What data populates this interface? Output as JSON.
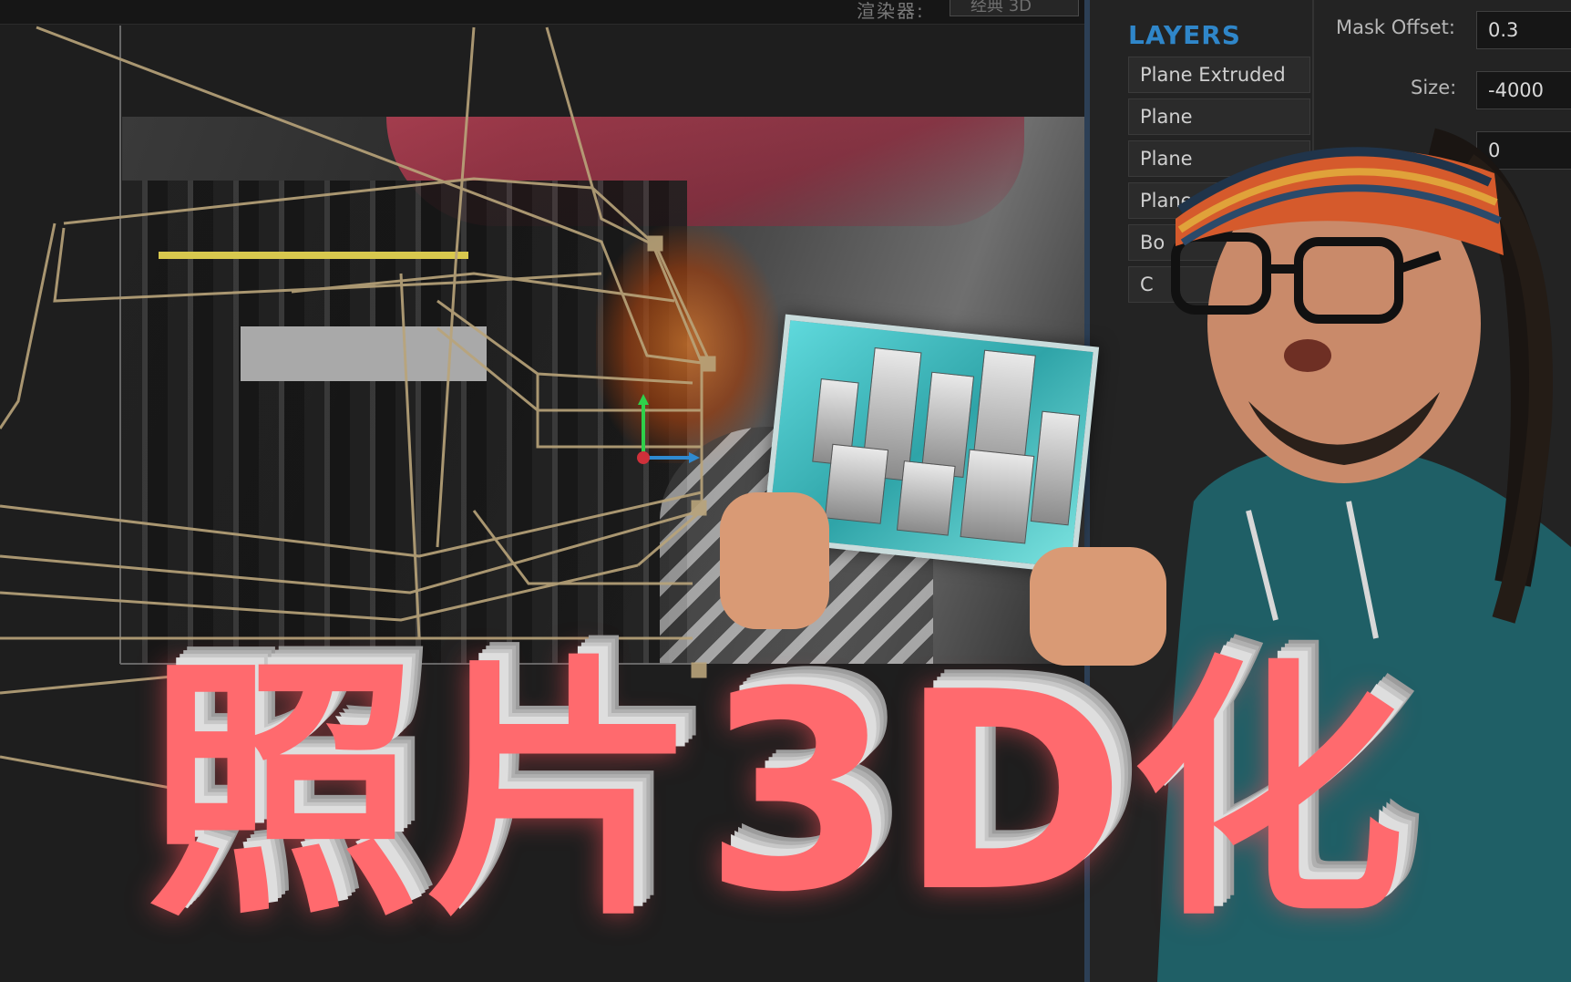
{
  "toolbar": {
    "renderer_label": "渲染器:",
    "renderer_value": "经典 3D"
  },
  "layers_panel": {
    "title": "LAYERS",
    "items": [
      {
        "label": "Plane  Extruded"
      },
      {
        "label": "Plane"
      },
      {
        "label": "Plane"
      },
      {
        "label": "Plane"
      },
      {
        "label": "Bo"
      },
      {
        "label": "C"
      }
    ]
  },
  "properties": {
    "mask_offset_label": "Mask Offset:",
    "mask_offset_value": "0.3",
    "size_label": "Size:",
    "size_value": "-4000",
    "third_value": "0"
  },
  "headline": {
    "text": "照片3D化"
  },
  "colors": {
    "accent_blue": "#2f86c9",
    "headline_red": "#ff6a6e",
    "hoodie_teal": "#1f5f66",
    "wireframe": "#b9a47a"
  }
}
